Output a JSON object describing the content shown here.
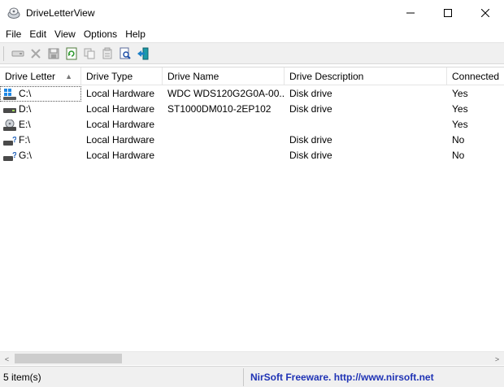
{
  "window": {
    "title": "DriveLetterView",
    "controls": {
      "minimize": "—",
      "maximize": "☐",
      "close": "✕"
    }
  },
  "menu": [
    "File",
    "Edit",
    "View",
    "Options",
    "Help"
  ],
  "toolbar": {
    "buttons": [
      "drive-icon",
      "delete-icon",
      "save-icon",
      "refresh-icon",
      "copy-icon",
      "properties-icon",
      "find-icon",
      "exit-icon"
    ]
  },
  "columns": [
    "Drive Letter",
    "Drive Type",
    "Drive Name",
    "Drive Description",
    "Connected"
  ],
  "sort_indicator": "▲",
  "rows": [
    {
      "letter": "C:\\",
      "type": "Local Hardware",
      "name": "WDC WDS120G2G0A-00...",
      "desc": "Disk drive",
      "connected": "Yes",
      "icon": "windows-drive-icon"
    },
    {
      "letter": "D:\\",
      "type": "Local Hardware",
      "name": "ST1000DM010-2EP102",
      "desc": "Disk drive",
      "connected": "Yes",
      "icon": "hard-drive-icon"
    },
    {
      "letter": "E:\\",
      "type": "Local Hardware",
      "name": "",
      "desc": "",
      "connected": "Yes",
      "icon": "optical-drive-icon"
    },
    {
      "letter": "F:\\",
      "type": "Local Hardware",
      "name": "",
      "desc": "Disk drive",
      "connected": "No",
      "icon": "unknown-drive-icon"
    },
    {
      "letter": "G:\\",
      "type": "Local Hardware",
      "name": "",
      "desc": "Disk drive",
      "connected": "No",
      "icon": "unknown-drive-icon"
    }
  ],
  "scrollbar": {
    "left_arrow": "<",
    "right_arrow": ">"
  },
  "status": {
    "count": "5 item(s)",
    "credit": "NirSoft Freeware.  http://www.nirsoft.net"
  },
  "colors": {
    "credit": "#1f33b5",
    "accent": "#0078d7"
  }
}
